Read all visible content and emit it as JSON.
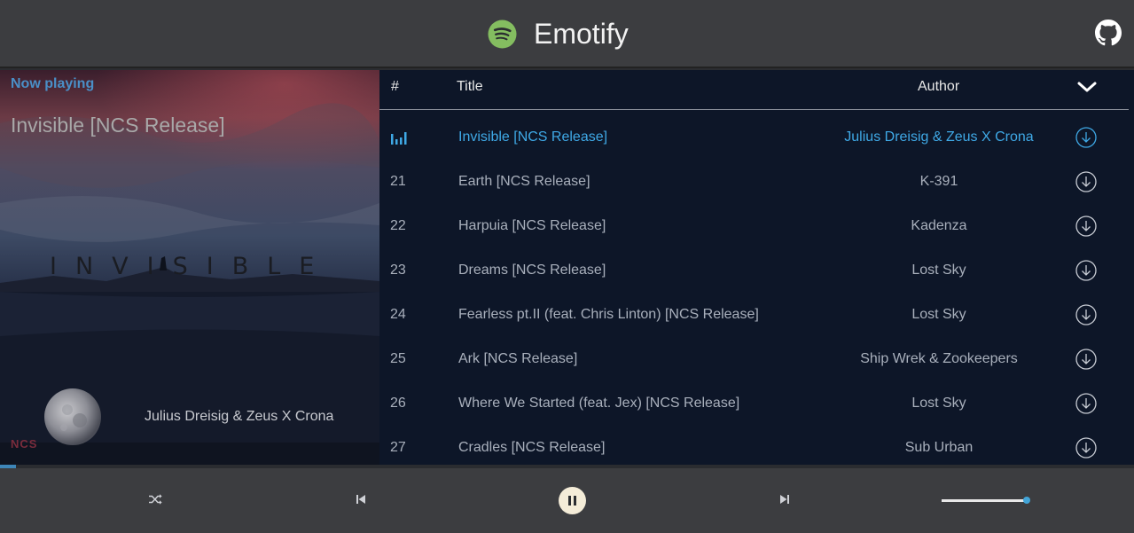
{
  "app": {
    "name": "Emotify",
    "logo_icon": "spotify-icon",
    "github_icon": "github-icon"
  },
  "now_playing": {
    "label": "Now playing",
    "title": "Invisible [NCS Release]",
    "artist": "Julius Dreisig & Zeus X Crona",
    "cover_text": "INVISIBLE",
    "cover_logo": "NCS"
  },
  "tracklist": {
    "columns": {
      "num": "#",
      "title": "Title",
      "author": "Author"
    },
    "collapse_icon": "chevron-down-icon",
    "tracks": [
      {
        "num": "",
        "title": "Invisible [NCS Release]",
        "author": "Julius Dreisig & Zeus X Crona",
        "active": true
      },
      {
        "num": "21",
        "title": "Earth [NCS Release]",
        "author": "K-391",
        "active": false
      },
      {
        "num": "22",
        "title": "Harpuia [NCS Release]",
        "author": "Kadenza",
        "active": false
      },
      {
        "num": "23",
        "title": "Dreams [NCS Release]",
        "author": "Lost Sky",
        "active": false
      },
      {
        "num": "24",
        "title": "Fearless pt.II (feat. Chris Linton) [NCS Release]",
        "author": "Lost Sky",
        "active": false
      },
      {
        "num": "25",
        "title": "Ark [NCS Release]",
        "author": "Ship Wrek & Zookeepers",
        "active": false
      },
      {
        "num": "26",
        "title": "Where We Started (feat. Jex) [NCS Release]",
        "author": "Lost Sky",
        "active": false
      },
      {
        "num": "27",
        "title": "Cradles [NCS Release]",
        "author": "Sub Urban",
        "active": false
      }
    ]
  },
  "player": {
    "progress": 0.014,
    "volume": 1.0,
    "state": "playing",
    "icons": [
      "shuffle-icon",
      "previous-icon",
      "pause-icon",
      "next-icon"
    ]
  },
  "colors": {
    "accent": "#3fa9e6",
    "spotify_green": "#84bd60",
    "header_bg": "#3c3d40",
    "list_bg": "#0d1628"
  }
}
